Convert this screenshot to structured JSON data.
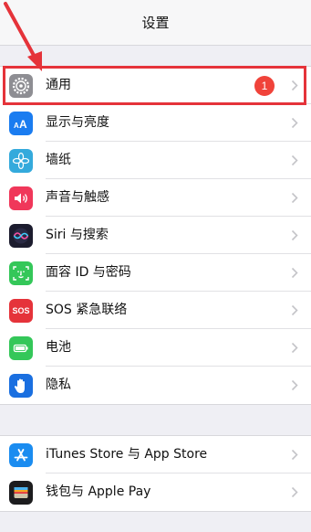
{
  "header": {
    "title": "设置"
  },
  "group1": [
    {
      "name": "general",
      "label": "通用",
      "badge": "1",
      "icon": "gear-icon",
      "color": "#8e8e93"
    },
    {
      "name": "display",
      "label": "显示与亮度",
      "icon": "text-size-icon",
      "color": "#1a7cf0"
    },
    {
      "name": "wallpaper",
      "label": "墙纸",
      "icon": "flower-icon",
      "color": "#34aadc"
    },
    {
      "name": "sounds",
      "label": "声音与触感",
      "icon": "speaker-icon",
      "color": "#f0375a"
    },
    {
      "name": "siri",
      "label": "Siri 与搜索",
      "icon": "siri-icon",
      "color": "#1c1c2e"
    },
    {
      "name": "faceid",
      "label": "面容 ID 与密码",
      "icon": "face-id-icon",
      "color": "#34c759"
    },
    {
      "name": "sos",
      "label": "SOS 紧急联络",
      "icon": "sos-icon",
      "color": "#e5333a",
      "icon_text": "SOS"
    },
    {
      "name": "battery",
      "label": "电池",
      "icon": "battery-icon",
      "color": "#34c759"
    },
    {
      "name": "privacy",
      "label": "隐私",
      "icon": "hand-icon",
      "color": "#1a6fe0"
    }
  ],
  "group2": [
    {
      "name": "appstore",
      "label": "iTunes Store 与 App Store",
      "icon": "app-store-icon",
      "color": "#1a8cf0"
    },
    {
      "name": "wallet",
      "label": "钱包与 Apple Pay",
      "icon": "wallet-icon",
      "color": "#1c1c1e"
    }
  ],
  "annotation": {
    "color": "#e5333a"
  }
}
